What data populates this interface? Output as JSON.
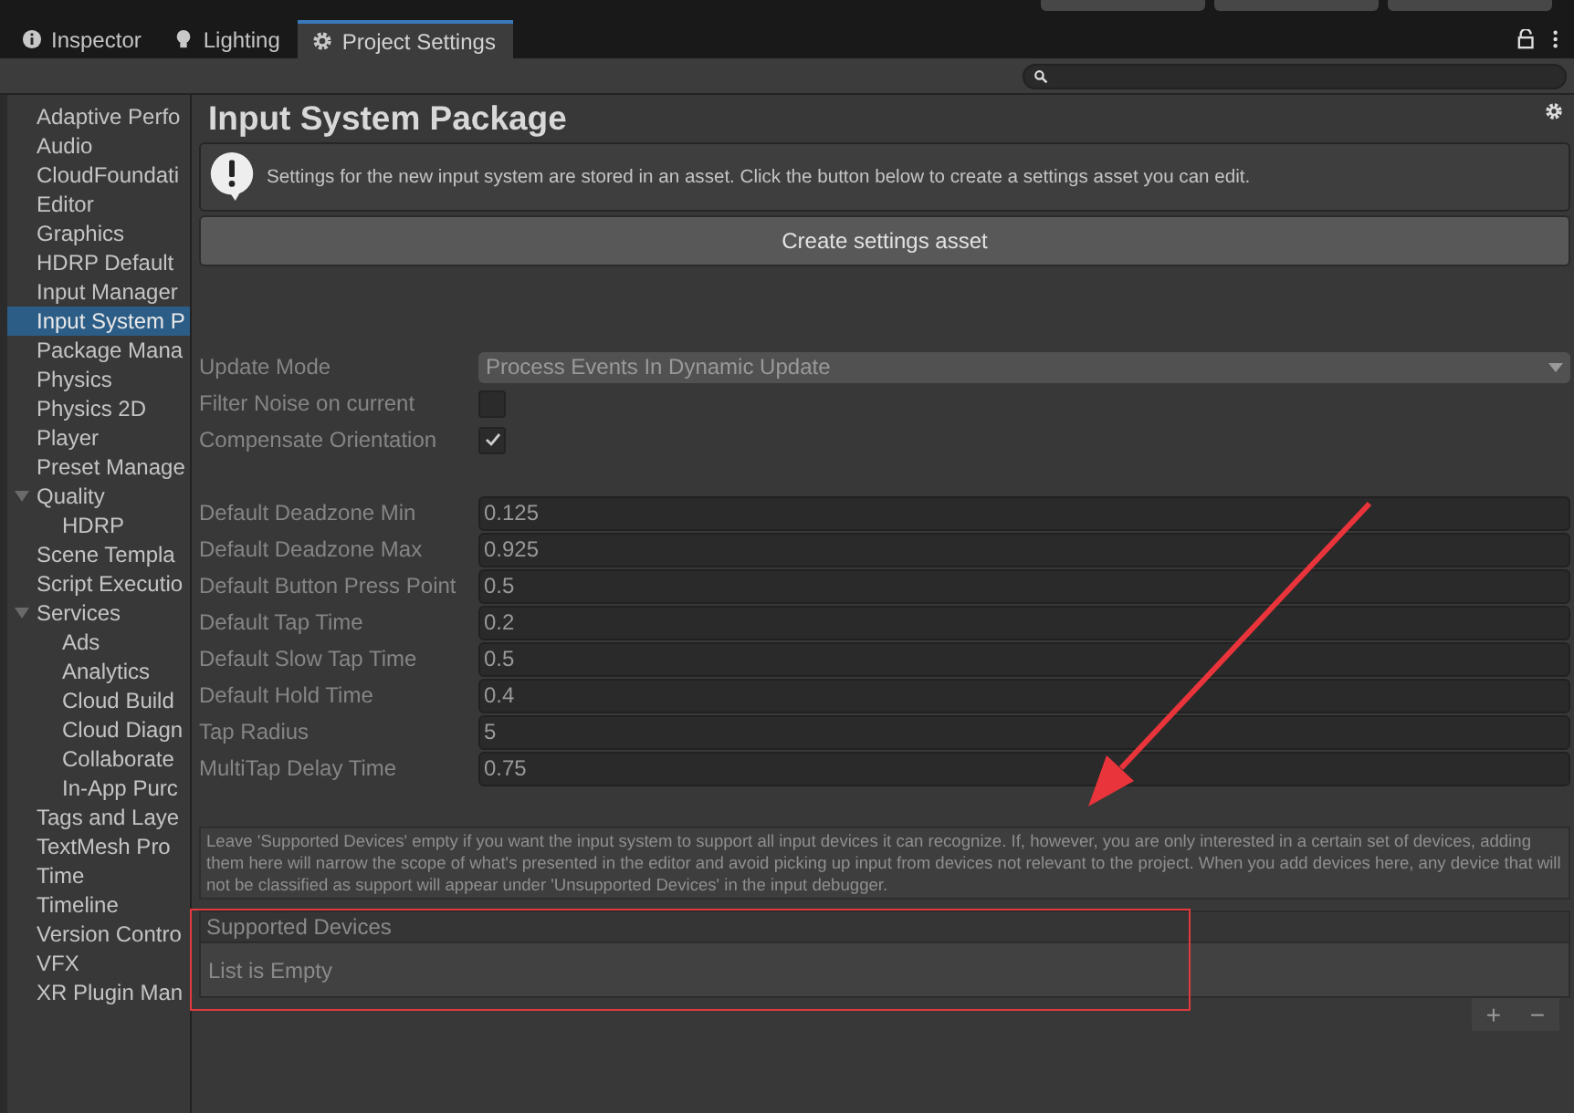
{
  "tabs": [
    {
      "label": "Inspector",
      "selected": false
    },
    {
      "label": "Lighting",
      "selected": false
    },
    {
      "label": "Project Settings",
      "selected": true
    }
  ],
  "sidebar": {
    "items": [
      {
        "label": "Adaptive Perfo",
        "selected": false
      },
      {
        "label": "Audio",
        "selected": false
      },
      {
        "label": "CloudFoundati",
        "selected": false
      },
      {
        "label": "Editor",
        "selected": false
      },
      {
        "label": "Graphics",
        "selected": false
      },
      {
        "label": "HDRP Default",
        "selected": false
      },
      {
        "label": "Input Manager",
        "selected": false
      },
      {
        "label": "Input System P",
        "selected": true
      },
      {
        "label": "Package Mana",
        "selected": false
      },
      {
        "label": "Physics",
        "selected": false
      },
      {
        "label": "Physics 2D",
        "selected": false
      },
      {
        "label": "Player",
        "selected": false
      },
      {
        "label": "Preset Manage",
        "selected": false
      },
      {
        "label": "Quality",
        "selected": false,
        "expanded": true,
        "children": [
          {
            "label": "HDRP",
            "selected": false
          }
        ]
      },
      {
        "label": "Scene Templa",
        "selected": false
      },
      {
        "label": "Script Executio",
        "selected": false
      },
      {
        "label": "Services",
        "selected": false,
        "expanded": true,
        "children": [
          {
            "label": "Ads",
            "selected": false
          },
          {
            "label": "Analytics",
            "selected": false
          },
          {
            "label": "Cloud Build",
            "selected": false
          },
          {
            "label": "Cloud Diagn",
            "selected": false
          },
          {
            "label": "Collaborate",
            "selected": false
          },
          {
            "label": "In-App Purc",
            "selected": false
          }
        ]
      },
      {
        "label": "Tags and Laye",
        "selected": false
      },
      {
        "label": "TextMesh Pro",
        "selected": false
      },
      {
        "label": "Time",
        "selected": false
      },
      {
        "label": "Timeline",
        "selected": false
      },
      {
        "label": "Version Contro",
        "selected": false
      },
      {
        "label": "VFX",
        "selected": false
      },
      {
        "label": "XR Plugin Man",
        "selected": false
      }
    ]
  },
  "page": {
    "title": "Input System Package",
    "notice": "Settings for the new input system are stored in an asset. Click the button below to create a settings asset you can edit.",
    "create_button": "Create settings asset",
    "settings_disabled": true,
    "groups": [
      [
        {
          "kind": "dropdown",
          "label": "Update Mode",
          "value": "Process Events In Dynamic Update"
        },
        {
          "kind": "checkbox",
          "label": "Filter Noise on current",
          "checked": false
        },
        {
          "kind": "checkbox",
          "label": "Compensate Orientation",
          "checked": true
        }
      ],
      [
        {
          "kind": "number",
          "label": "Default Deadzone Min",
          "value": "0.125"
        },
        {
          "kind": "number",
          "label": "Default Deadzone Max",
          "value": "0.925"
        },
        {
          "kind": "number",
          "label": "Default Button Press Point",
          "value": "0.5"
        },
        {
          "kind": "number",
          "label": "Default Tap Time",
          "value": "0.2"
        },
        {
          "kind": "number",
          "label": "Default Slow Tap Time",
          "value": "0.5"
        },
        {
          "kind": "number",
          "label": "Default Hold Time",
          "value": "0.4"
        },
        {
          "kind": "number",
          "label": "Tap Radius",
          "value": "5"
        },
        {
          "kind": "number",
          "label": "MultiTap Delay Time",
          "value": "0.75"
        }
      ]
    ],
    "devices_help": "Leave 'Supported Devices' empty if you want the input system to support all input devices it can recognize. If, however, you are only interested in a certain set of devices, adding them here will narrow the scope of what's presented in the editor and avoid picking up input from devices not relevant to the project. When you add devices here, any device that will not be classified as support will appear under 'Unsupported Devices' in the input debugger.",
    "devices_header": "Supported Devices",
    "devices_empty": "List is Empty",
    "add_button": "+",
    "remove_button": "−"
  }
}
